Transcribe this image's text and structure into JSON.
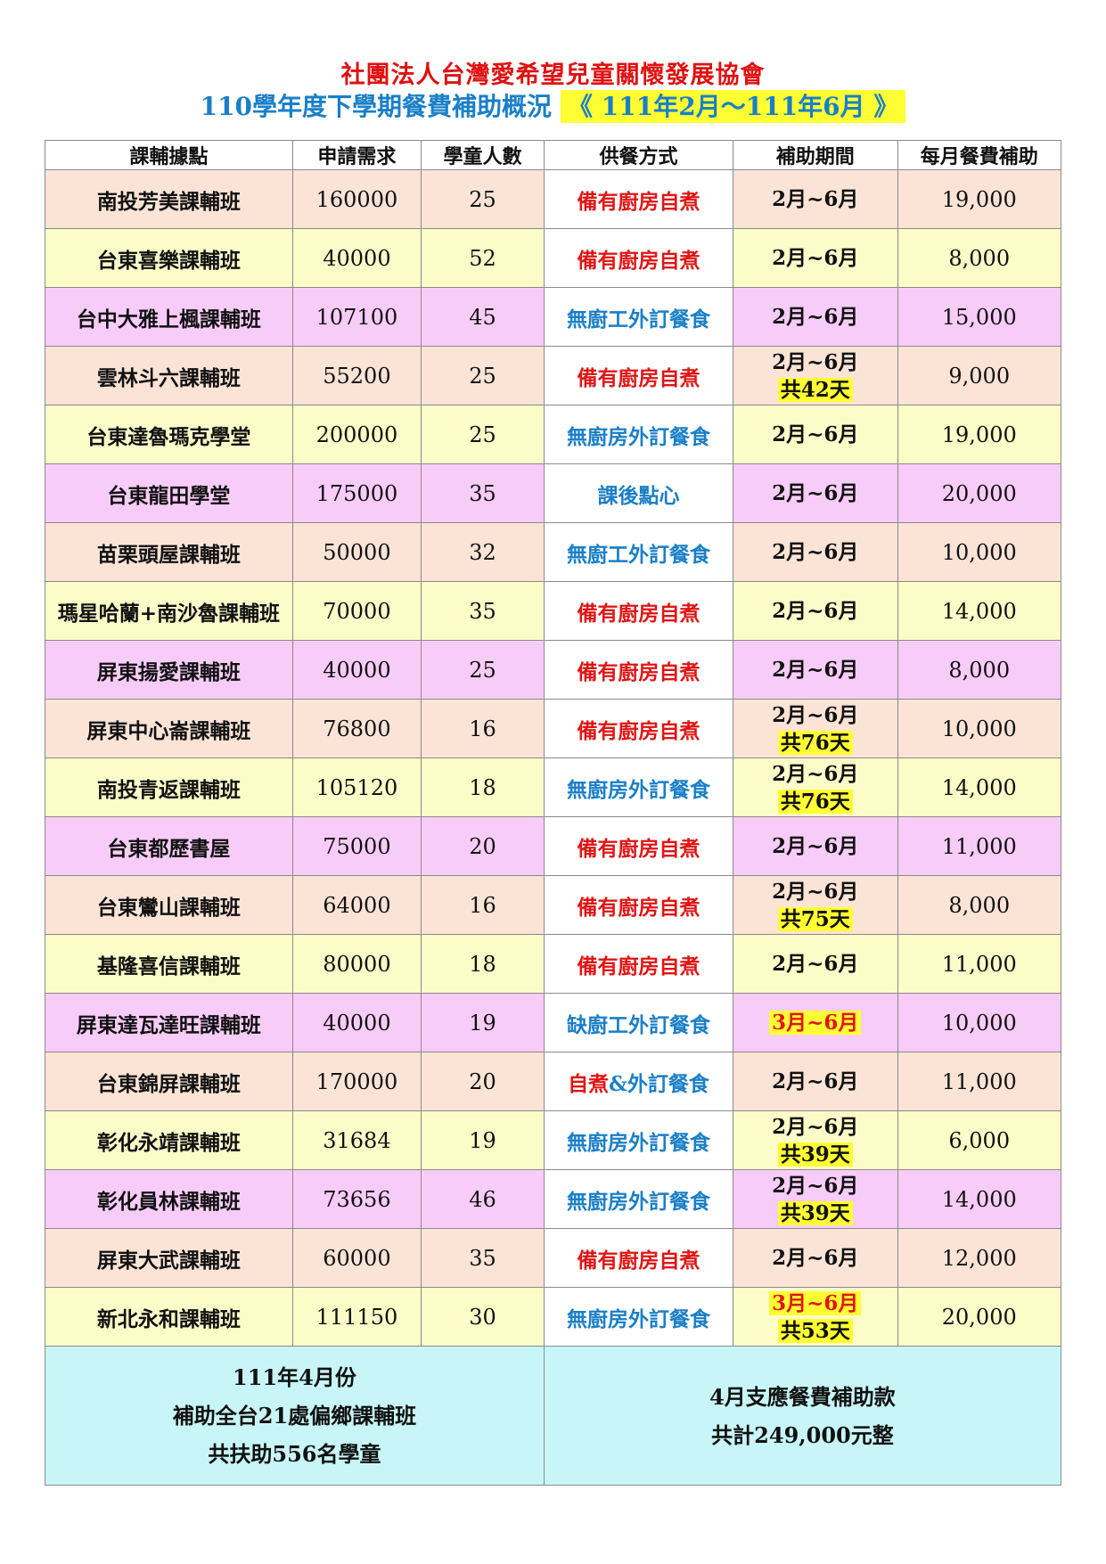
{
  "header": {
    "org": "社團法人台灣愛希望兒童關懷發展協會",
    "title": "110學年度下學期餐費補助概況",
    "period": "《 111年2月～111年6月 》"
  },
  "table": {
    "columns": [
      "課輔據點",
      "申請需求",
      "學童人數",
      "供餐方式",
      "補助期間",
      "每月餐費補助"
    ],
    "rows": [
      {
        "site": "南投芳美課輔班",
        "request": "160000",
        "students": "25",
        "meal": "備有廚房自煮",
        "meal_color": "red",
        "period": "2月~6月",
        "days": "",
        "monthly": "19,000",
        "bg": "peach"
      },
      {
        "site": "台東喜樂課輔班",
        "request": "40000",
        "students": "52",
        "meal": "備有廚房自煮",
        "meal_color": "red",
        "period": "2月~6月",
        "days": "",
        "monthly": "8,000",
        "bg": "yellow"
      },
      {
        "site": "台中大雅上楓課輔班",
        "request": "107100",
        "students": "45",
        "meal": "無廚工外訂餐食",
        "meal_color": "blue",
        "period": "2月~6月",
        "days": "",
        "monthly": "15,000",
        "bg": "pink"
      },
      {
        "site": "雲林斗六課輔班",
        "request": "55200",
        "students": "25",
        "meal": "備有廚房自煮",
        "meal_color": "red",
        "period": "2月~6月",
        "days": "共42天",
        "monthly": "9,000",
        "bg": "peach"
      },
      {
        "site": "台東達魯瑪克學堂",
        "request": "200000",
        "students": "25",
        "meal": "無廚房外訂餐食",
        "meal_color": "blue",
        "period": "2月~6月",
        "days": "",
        "monthly": "19,000",
        "bg": "yellow"
      },
      {
        "site": "台東龍田學堂",
        "request": "175000",
        "students": "35",
        "meal": "課後點心",
        "meal_color": "blue",
        "period": "2月~6月",
        "days": "",
        "monthly": "20,000",
        "bg": "pink"
      },
      {
        "site": "苗栗頭屋課輔班",
        "request": "50000",
        "students": "32",
        "meal": "無廚工外訂餐食",
        "meal_color": "blue",
        "period": "2月~6月",
        "days": "",
        "monthly": "10,000",
        "bg": "peach"
      },
      {
        "site": "瑪星哈蘭+南沙魯課輔班",
        "request": "70000",
        "students": "35",
        "meal": "備有廚房自煮",
        "meal_color": "red",
        "period": "2月~6月",
        "days": "",
        "monthly": "14,000",
        "bg": "yellow"
      },
      {
        "site": "屏東揚愛課輔班",
        "request": "40000",
        "students": "25",
        "meal": "備有廚房自煮",
        "meal_color": "red",
        "period": "2月~6月",
        "days": "",
        "monthly": "8,000",
        "bg": "pink"
      },
      {
        "site": "屏東中心崙課輔班",
        "request": "76800",
        "students": "16",
        "meal": "備有廚房自煮",
        "meal_color": "red",
        "period": "2月~6月",
        "days": "共76天",
        "monthly": "10,000",
        "bg": "peach"
      },
      {
        "site": "南投青返課輔班",
        "request": "105120",
        "students": "18",
        "meal": "無廚房外訂餐食",
        "meal_color": "blue",
        "period": "2月~6月",
        "days": "共76天",
        "monthly": "14,000",
        "bg": "yellow"
      },
      {
        "site": "台東都歷書屋",
        "request": "75000",
        "students": "20",
        "meal": "備有廚房自煮",
        "meal_color": "red",
        "period": "2月~6月",
        "days": "",
        "monthly": "11,000",
        "bg": "pink"
      },
      {
        "site": "台東鸞山課輔班",
        "request": "64000",
        "students": "16",
        "meal": "備有廚房自煮",
        "meal_color": "red",
        "period": "2月~6月",
        "days": "共75天",
        "monthly": "8,000",
        "bg": "peach"
      },
      {
        "site": "基隆喜信課輔班",
        "request": "80000",
        "students": "18",
        "meal": "備有廚房自煮",
        "meal_color": "red",
        "period": "2月~6月",
        "days": "",
        "monthly": "11,000",
        "bg": "yellow"
      },
      {
        "site": "屏東達瓦達旺課輔班",
        "request": "40000",
        "students": "19",
        "meal": "缺廚工外訂餐食",
        "meal_color": "blue",
        "period": "3月~6月",
        "period_highlight": true,
        "days": "",
        "monthly": "10,000",
        "bg": "pink"
      },
      {
        "site": "台東錦屏課輔班",
        "request": "170000",
        "students": "20",
        "meal": "自煮&外訂餐食",
        "meal_color": "mixed",
        "meal_part1": "自煮",
        "meal_part2": "&外訂餐食",
        "period": "2月~6月",
        "days": "",
        "monthly": "11,000",
        "bg": "peach"
      },
      {
        "site": "彰化永靖課輔班",
        "request": "31684",
        "students": "19",
        "meal": "無廚房外訂餐食",
        "meal_color": "blue",
        "period": "2月~6月",
        "days": "共39天",
        "monthly": "6,000",
        "bg": "yellow"
      },
      {
        "site": "彰化員林課輔班",
        "request": "73656",
        "students": "46",
        "meal": "無廚房外訂餐食",
        "meal_color": "blue",
        "period": "2月~6月",
        "days": "共39天",
        "monthly": "14,000",
        "bg": "pink"
      },
      {
        "site": "屏東大武課輔班",
        "request": "60000",
        "students": "35",
        "meal": "備有廚房自煮",
        "meal_color": "red",
        "period": "2月~6月",
        "days": "",
        "monthly": "12,000",
        "bg": "peach"
      },
      {
        "site": "新北永和課輔班",
        "request": "111150",
        "students": "30",
        "meal": "無廚房外訂餐食",
        "meal_color": "blue",
        "period": "3月~6月",
        "period_highlight": true,
        "days": "共53天",
        "monthly": "20,000",
        "bg": "yellow"
      }
    ]
  },
  "footer": {
    "left": [
      "111年4月份",
      "補助全台21處偏鄉課輔班",
      "共扶助556名學童"
    ],
    "right": [
      "4月支應餐費補助款",
      "共計249,000元整"
    ]
  }
}
